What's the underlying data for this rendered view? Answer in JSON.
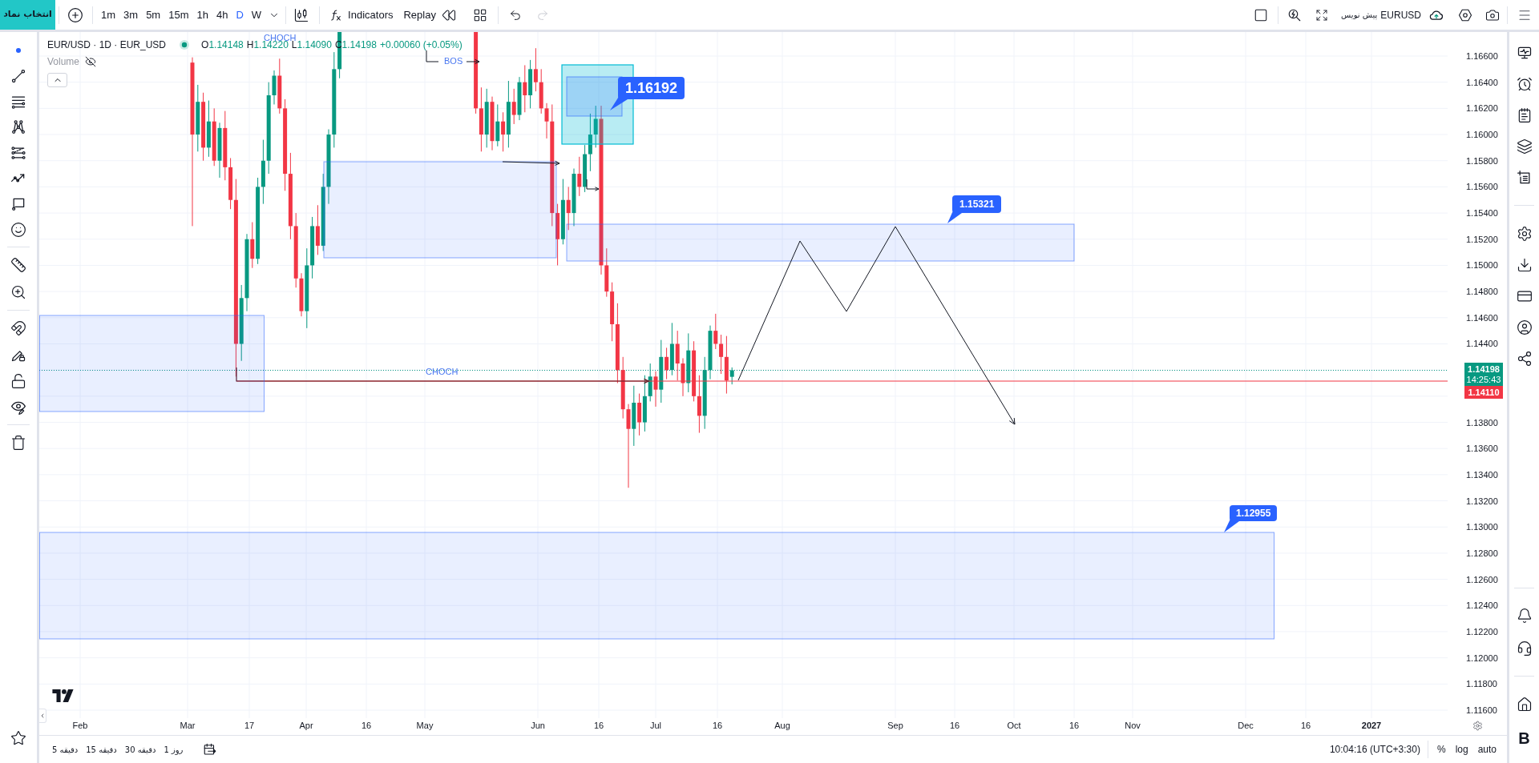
{
  "toolbar": {
    "symbol_button": "انتخاب نماد",
    "intervals": [
      {
        "label": "1m",
        "selected": false
      },
      {
        "label": "3m",
        "selected": false
      },
      {
        "label": "5m",
        "selected": false
      },
      {
        "label": "15m",
        "selected": false
      },
      {
        "label": "1h",
        "selected": false
      },
      {
        "label": "4h",
        "selected": false
      },
      {
        "label": "D",
        "selected": true
      },
      {
        "label": "W",
        "selected": false
      }
    ],
    "indicators": "Indicators",
    "replay": "Replay",
    "redo": {
      "disabled": true
    },
    "save_status": "پیش نویس",
    "layout_name": "EURUSD"
  },
  "legend": {
    "title": "EUR/USD · 1D · EUR_USD",
    "market_open": true,
    "ohlc": [
      {
        "label": "O",
        "value": "1.14148"
      },
      {
        "label": "H",
        "value": "1.14220"
      },
      {
        "label": "L",
        "value": "1.14090"
      },
      {
        "label": "C",
        "value": "1.14198"
      }
    ],
    "change": "+0.00060 (+0.05%)",
    "volume": {
      "label": "Volume",
      "hidden": true
    }
  },
  "drawings": {
    "annotations": [
      {
        "text": "CHOCH"
      },
      {
        "text": "BOS"
      },
      {
        "text": "CHOCH"
      }
    ],
    "price_labels": [
      {
        "text": "1.16192"
      },
      {
        "text": "1.15321"
      },
      {
        "text": "1.12955"
      }
    ]
  },
  "price_axis": {
    "ticks": [
      "1.16600",
      "1.16400",
      "1.16200",
      "1.16000",
      "1.15800",
      "1.15600",
      "1.15400",
      "1.15200",
      "1.15000",
      "1.14800",
      "1.14600",
      "1.14400",
      "1.13800",
      "1.13600",
      "1.13400",
      "1.13200",
      "1.13000",
      "1.12800",
      "1.12600",
      "1.12400",
      "1.12200",
      "1.12000",
      "1.11800",
      "1.11600"
    ],
    "last_price": "1.14198",
    "countdown": "14:25:43",
    "level_price": "1.14110"
  },
  "time_axis": {
    "ticks": [
      {
        "label": "Feb",
        "kind": "date"
      },
      {
        "label": "Mar",
        "kind": "date"
      },
      {
        "label": "17",
        "kind": "date"
      },
      {
        "label": "Apr",
        "kind": "date"
      },
      {
        "label": "16",
        "kind": "date"
      },
      {
        "label": "May",
        "kind": "date"
      },
      {
        "label": "Jun",
        "kind": "date"
      },
      {
        "label": "16",
        "kind": "date"
      },
      {
        "label": "Jul",
        "kind": "date"
      },
      {
        "label": "16",
        "kind": "date"
      },
      {
        "label": "Aug",
        "kind": "date"
      },
      {
        "label": "Sep",
        "kind": "date"
      },
      {
        "label": "16",
        "kind": "date"
      },
      {
        "label": "Oct",
        "kind": "date"
      },
      {
        "label": "16",
        "kind": "date"
      },
      {
        "label": "Nov",
        "kind": "date"
      },
      {
        "label": "Dec",
        "kind": "date"
      },
      {
        "label": "16",
        "kind": "date"
      },
      {
        "label": "2027",
        "kind": "year"
      }
    ]
  },
  "bottom_bar": {
    "ranges": [
      "1 روز",
      "30 دقیقه",
      "15 دقیقه",
      "5 دقیقه"
    ],
    "clock": "10:04:16 (UTC+3:30)",
    "scale_options": [
      "%",
      "log",
      "auto"
    ]
  },
  "right_sidebar": {
    "badge": "B"
  }
}
